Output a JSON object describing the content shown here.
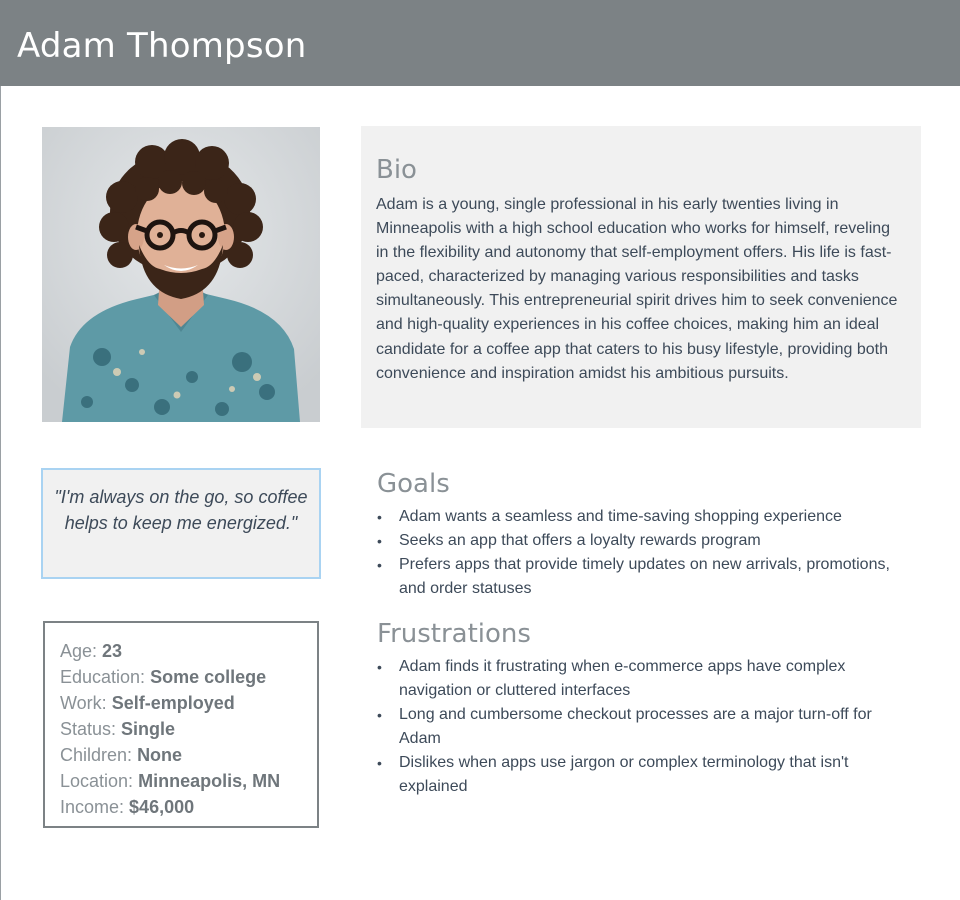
{
  "header": {
    "name": "Adam Thompson"
  },
  "photo": {
    "alt": "Portrait of Adam Thompson"
  },
  "bio": {
    "title": "Bio",
    "text": "Adam is a young, single professional in his early twenties living in Minneapolis with a high school education who works for himself, reveling in the flexibility and autonomy that self-employment offers. His life is fast-paced, characterized by managing various responsibilities and tasks simultaneously. This entrepreneurial spirit drives him to seek convenience and high-quality experiences in his coffee choices, making him an ideal candidate for a coffee app that caters to his busy lifestyle, providing both convenience and inspiration amidst his ambitious pursuits."
  },
  "quote": {
    "text": "\"I'm always on the go, so coffee helps to keep me energized.\""
  },
  "facts": [
    {
      "label": "Age:",
      "value": "23"
    },
    {
      "label": "Education:",
      "value": "Some college"
    },
    {
      "label": "Work:",
      "value": "Self-employed"
    },
    {
      "label": "Status:",
      "value": "Single"
    },
    {
      "label": "Children:",
      "value": "None"
    },
    {
      "label": "Location:",
      "value": "Minneapolis, MN"
    },
    {
      "label": "Income:",
      "value": "$46,000"
    }
  ],
  "goals": {
    "title": "Goals",
    "items": [
      "Adam wants a seamless and time-saving shopping experience",
      "Seeks an app that offers a loyalty rewards program",
      "Prefers apps that provide timely updates on new arrivals, promotions, and order statuses"
    ]
  },
  "frustrations": {
    "title": "Frustrations",
    "items": [
      "Adam finds it frustrating when e-commerce apps have complex navigation or cluttered interfaces",
      "Long and cumbersome checkout processes are a major turn-off for Adam",
      "Dislikes when apps use jargon or complex terminology that isn't explained"
    ]
  },
  "colors": {
    "header_bg": "#7c8285",
    "panel_bg": "#f1f1f1",
    "quote_border": "#a9d3f2",
    "text": "#3d4a59",
    "muted": "#8a9196"
  }
}
